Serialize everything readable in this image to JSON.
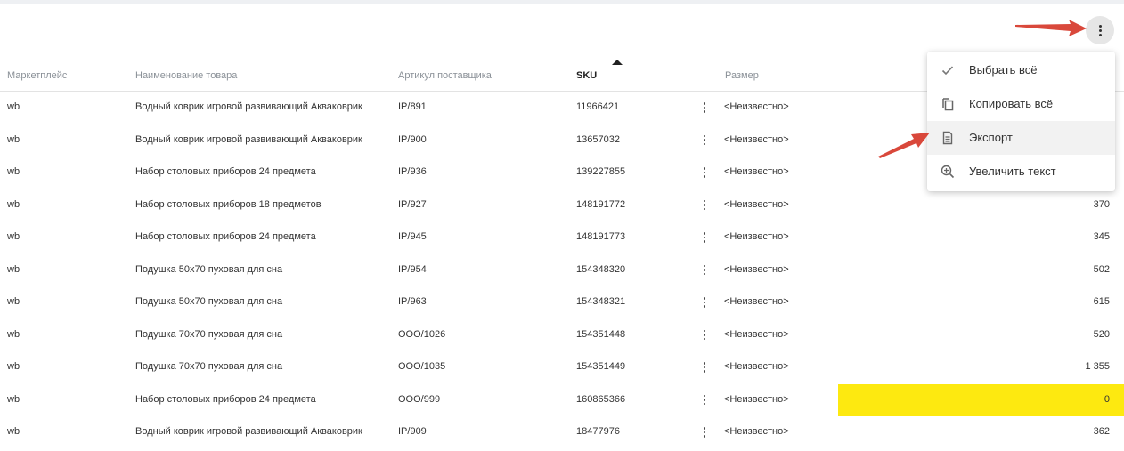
{
  "columns": {
    "marketplace": "Маркетплейс",
    "name": "Наименование товара",
    "article": "Артикул поставщика",
    "sku": "SKU",
    "size": "Размер"
  },
  "rows": [
    {
      "mp": "wb",
      "name": "Водный коврик игровой развивающий Акваковрик",
      "article": "IP/891",
      "sku": "11966421",
      "size": "<Неизвестно>",
      "value": ""
    },
    {
      "mp": "wb",
      "name": "Водный коврик игровой развивающий Акваковрик",
      "article": "IP/900",
      "sku": "13657032",
      "size": "<Неизвестно>",
      "value": ""
    },
    {
      "mp": "wb",
      "name": "Набор столовых приборов 24 предмета",
      "article": "IP/936",
      "sku": "139227855",
      "size": "<Неизвестно>",
      "value": ""
    },
    {
      "mp": "wb",
      "name": "Набор столовых приборов 18 предметов",
      "article": "IP/927",
      "sku": "148191772",
      "size": "<Неизвестно>",
      "value": "370"
    },
    {
      "mp": "wb",
      "name": "Набор столовых приборов 24 предмета",
      "article": "IP/945",
      "sku": "148191773",
      "size": "<Неизвестно>",
      "value": "345"
    },
    {
      "mp": "wb",
      "name": "Подушка 50x70 пуховая для сна",
      "article": "IP/954",
      "sku": "154348320",
      "size": "<Неизвестно>",
      "value": "502"
    },
    {
      "mp": "wb",
      "name": "Подушка 50x70 пуховая для сна",
      "article": "IP/963",
      "sku": "154348321",
      "size": "<Неизвестно>",
      "value": "615"
    },
    {
      "mp": "wb",
      "name": "Подушка 70x70 пуховая для сна",
      "article": "ООО/1026",
      "sku": "154351448",
      "size": "<Неизвестно>",
      "value": "520"
    },
    {
      "mp": "wb",
      "name": "Подушка 70x70 пуховая для сна",
      "article": "ООО/1035",
      "sku": "154351449",
      "size": "<Неизвестно>",
      "value": "1 355"
    },
    {
      "mp": "wb",
      "name": "Набор столовых приборов 24 предмета",
      "article": "ООО/999",
      "sku": "160865366",
      "size": "<Неизвестно>",
      "value": "0",
      "highlight": true
    },
    {
      "mp": "wb",
      "name": "Водный коврик игровой развивающий Акваковрик",
      "article": "IP/909",
      "sku": "18477976",
      "size": "<Неизвестно>",
      "value": "362"
    }
  ],
  "menu": {
    "items": [
      {
        "label": "Выбрать всё",
        "icon": "check-icon"
      },
      {
        "label": "Копировать всё",
        "icon": "copy-icon"
      },
      {
        "label": "Экспорт",
        "icon": "document-icon",
        "hovered": true
      },
      {
        "label": "Увеличить текст",
        "icon": "zoom-in-icon"
      }
    ]
  },
  "colors": {
    "highlight": "#fde910",
    "arrow": "#d9483b"
  }
}
